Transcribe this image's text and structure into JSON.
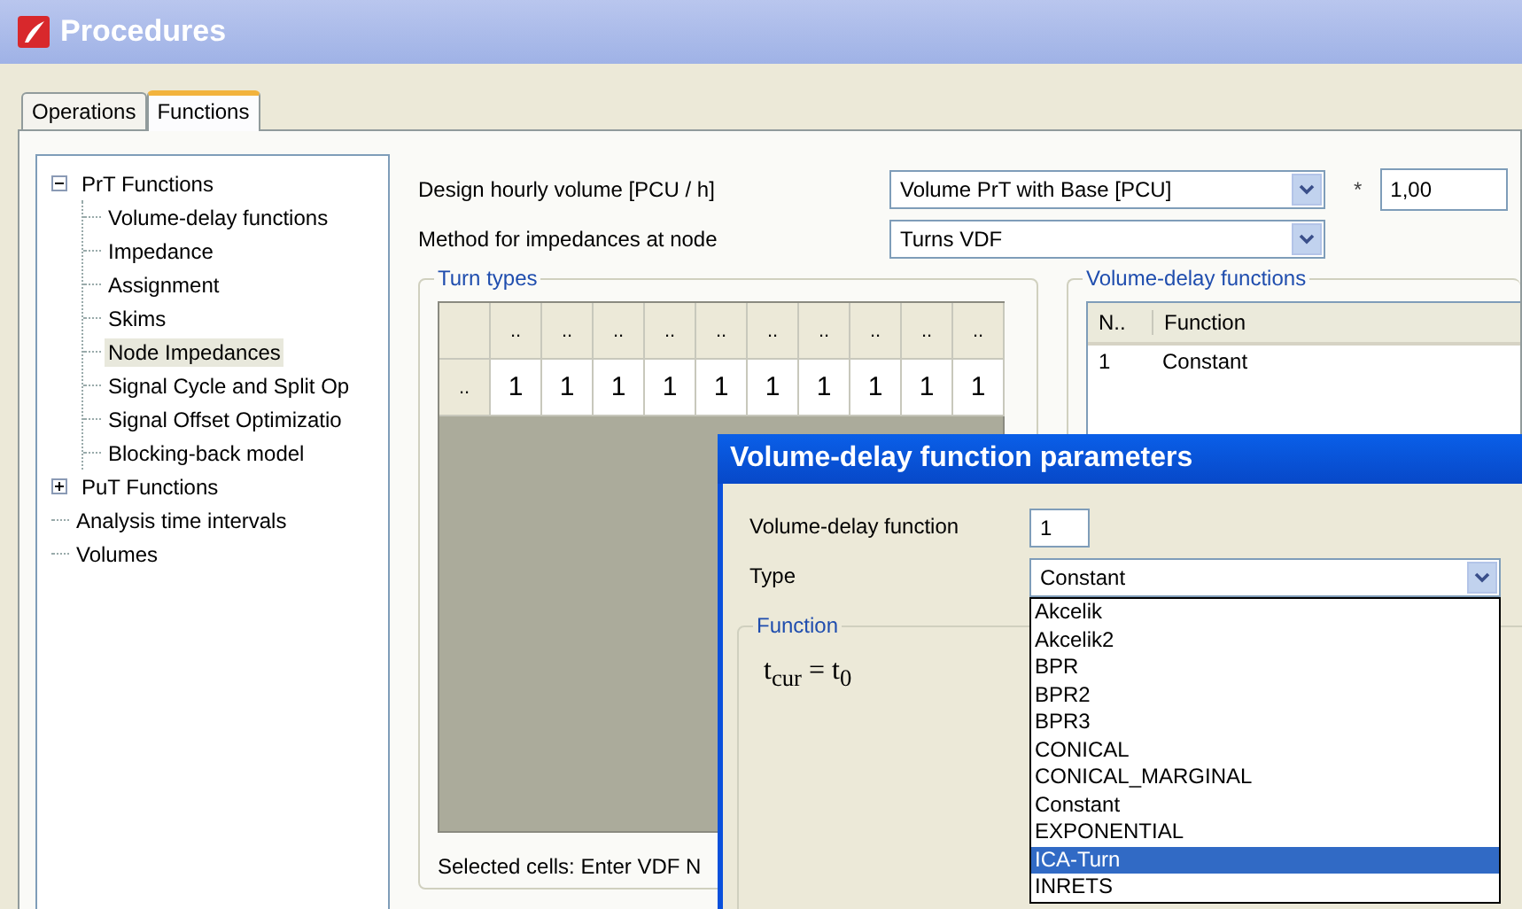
{
  "window": {
    "title": "Procedures"
  },
  "tabs": [
    {
      "label": "Operations",
      "selected": false
    },
    {
      "label": "Functions",
      "selected": true
    }
  ],
  "tree": [
    {
      "label": "PrT Functions",
      "expanded": true,
      "selected": false,
      "children": [
        {
          "label": "Volume-delay functions",
          "selected": false
        },
        {
          "label": "Impedance",
          "selected": false
        },
        {
          "label": "Assignment",
          "selected": false
        },
        {
          "label": "Skims",
          "selected": false
        },
        {
          "label": "Node Impedances",
          "selected": true
        },
        {
          "label": "Signal Cycle and Split Op",
          "selected": false
        },
        {
          "label": "Signal Offset Optimizatio",
          "selected": false
        },
        {
          "label": "Blocking-back model",
          "selected": false
        }
      ]
    },
    {
      "label": "PuT Functions",
      "expanded": false,
      "selected": false
    },
    {
      "label": "Analysis time intervals",
      "selected": false
    },
    {
      "label": "Volumes",
      "selected": false
    }
  ],
  "design_volume": {
    "label": "Design hourly volume [PCU / h]",
    "value": "Volume PrT with Base [PCU]",
    "operator": "*",
    "factor": "1,00"
  },
  "node_method": {
    "label": "Method for impedances at node",
    "value": "Turns VDF"
  },
  "turn_types": {
    "title": "Turn types",
    "columns": [
      "..",
      "..",
      "..",
      "..",
      "..",
      "..",
      "..",
      "..",
      "..",
      ".."
    ],
    "rows": [
      {
        "header": "..",
        "cells": [
          "1",
          "1",
          "1",
          "1",
          "1",
          "1",
          "1",
          "1",
          "1",
          "1"
        ]
      }
    ],
    "status": "Selected cells: Enter VDF N"
  },
  "vdf_list": {
    "title": "Volume-delay functions",
    "columns": [
      "N..",
      "Function"
    ],
    "rows": [
      [
        "1",
        "Constant"
      ]
    ]
  },
  "dialog": {
    "title": "Volume-delay function parameters",
    "vdf_label": "Volume-delay function",
    "vdf_value": "1",
    "type_label": "Type",
    "type_value": "Constant",
    "function_title": "Function",
    "formula": "t$_{cur}$ = t$_{0}$",
    "options": [
      {
        "label": "Akcelik",
        "selected": false
      },
      {
        "label": "Akcelik2",
        "selected": false
      },
      {
        "label": "BPR",
        "selected": false
      },
      {
        "label": "BPR2",
        "selected": false
      },
      {
        "label": "BPR3",
        "selected": false
      },
      {
        "label": "CONICAL",
        "selected": false
      },
      {
        "label": "CONICAL_MARGINAL",
        "selected": false
      },
      {
        "label": "Constant",
        "selected": false
      },
      {
        "label": "EXPONENTIAL",
        "selected": false
      },
      {
        "label": "ICA-Turn",
        "selected": true
      },
      {
        "label": "INRETS",
        "selected": false
      }
    ]
  }
}
